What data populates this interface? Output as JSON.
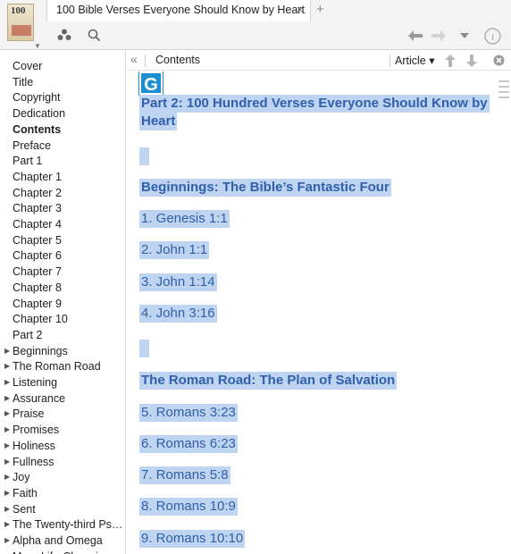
{
  "tab": {
    "title": "100 Bible Verses Everyone Should Know by Heart",
    "close": "×",
    "new": "+"
  },
  "thumb": {
    "text": "100"
  },
  "icons": [
    "resources-icon",
    "search-icon",
    "back-icon",
    "forward-icon",
    "dropdown-icon",
    "info-icon"
  ],
  "sidebar": {
    "items": [
      {
        "label": "Cover",
        "arrow": false,
        "bold": false
      },
      {
        "label": "Title",
        "arrow": false,
        "bold": false
      },
      {
        "label": "Copyright",
        "arrow": false,
        "bold": false
      },
      {
        "label": "Dedication",
        "arrow": false,
        "bold": false
      },
      {
        "label": "Contents",
        "arrow": false,
        "bold": true
      },
      {
        "label": "Preface",
        "arrow": false,
        "bold": false
      },
      {
        "label": "Part 1",
        "arrow": false,
        "bold": false
      },
      {
        "label": "Chapter 1",
        "arrow": false,
        "bold": false
      },
      {
        "label": "Chapter 2",
        "arrow": false,
        "bold": false
      },
      {
        "label": "Chapter 3",
        "arrow": false,
        "bold": false
      },
      {
        "label": "Chapter 4",
        "arrow": false,
        "bold": false
      },
      {
        "label": "Chapter 5",
        "arrow": false,
        "bold": false
      },
      {
        "label": "Chapter 6",
        "arrow": false,
        "bold": false
      },
      {
        "label": "Chapter 7",
        "arrow": false,
        "bold": false
      },
      {
        "label": "Chapter 8",
        "arrow": false,
        "bold": false
      },
      {
        "label": "Chapter 9",
        "arrow": false,
        "bold": false
      },
      {
        "label": "Chapter 10",
        "arrow": false,
        "bold": false
      },
      {
        "label": "Part 2",
        "arrow": false,
        "bold": false
      },
      {
        "label": "Beginnings",
        "arrow": true,
        "bold": false
      },
      {
        "label": "The Roman Road",
        "arrow": true,
        "bold": false
      },
      {
        "label": "Listening",
        "arrow": true,
        "bold": false
      },
      {
        "label": "Assurance",
        "arrow": true,
        "bold": false
      },
      {
        "label": "Praise",
        "arrow": true,
        "bold": false
      },
      {
        "label": "Promises",
        "arrow": true,
        "bold": false
      },
      {
        "label": "Holiness",
        "arrow": true,
        "bold": false
      },
      {
        "label": "Fullness",
        "arrow": true,
        "bold": false
      },
      {
        "label": "Joy",
        "arrow": true,
        "bold": false
      },
      {
        "label": "Faith",
        "arrow": true,
        "bold": false
      },
      {
        "label": "Sent",
        "arrow": true,
        "bold": false
      },
      {
        "label": "The Twenty-third Ps…",
        "arrow": true,
        "bold": false
      },
      {
        "label": "Alpha and Omega",
        "arrow": true,
        "bold": false
      },
      {
        "label": "More Life-Changing",
        "arrow": false,
        "bold": false
      }
    ]
  },
  "content_bar": {
    "collapse": "«",
    "title": "Contents",
    "article": "Article ▾"
  },
  "content": {
    "logo": "G",
    "heading_line1": "Part 2: 100 Hundred Verses Everyone Should Know by",
    "heading_line2": "Heart",
    "section1": "Beginnings: The Bible’s Fantastic Four",
    "list1": [
      "1. Genesis 1:1",
      "2. John 1:1",
      "3. John 1:14",
      "4. John 3:16"
    ],
    "section2": "The Roman Road: The Plan of Salvation",
    "list2": [
      "5. Romans 3:23",
      "6. Romans 6:23",
      "7. Romans 5:8",
      "8. Romans 10:9",
      "9. Romans 10:10"
    ]
  },
  "colors": {
    "selection": "#bfd4f0",
    "link_text": "#2f5fa7",
    "logo": "#1b8fd1"
  }
}
